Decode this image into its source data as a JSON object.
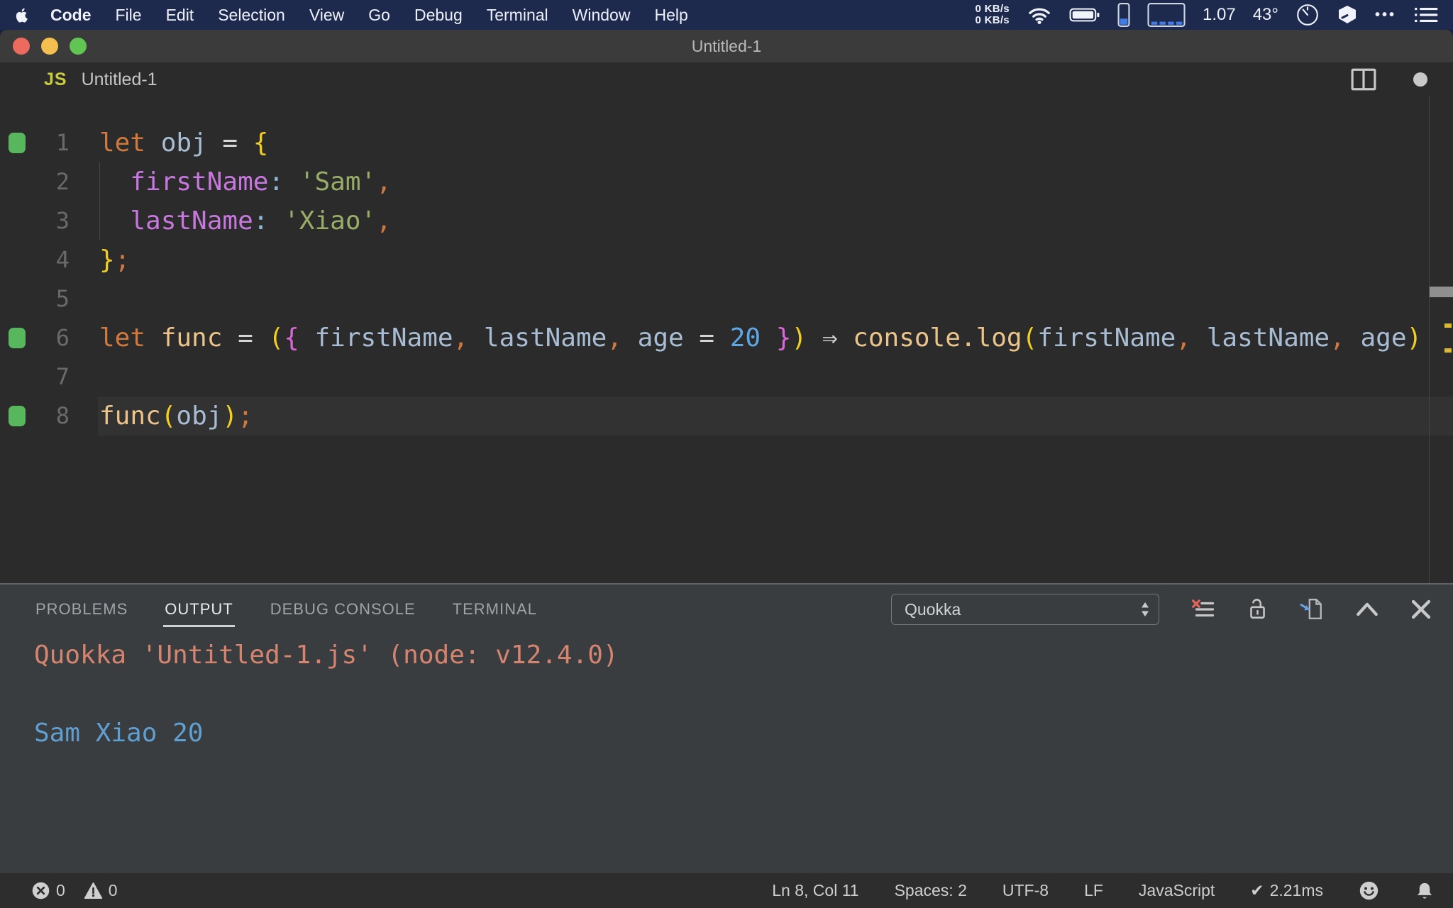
{
  "menubar": {
    "items": [
      "Code",
      "File",
      "Edit",
      "Selection",
      "View",
      "Go",
      "Debug",
      "Terminal",
      "Window",
      "Help"
    ],
    "net_up": "0 KB/s",
    "net_down": "0 KB/s",
    "stat1": "1.07",
    "stat2": "43°",
    "more_glyph": "•••"
  },
  "window": {
    "title": "Untitled-1"
  },
  "tabbar": {
    "file_badge": "JS",
    "filename": "Untitled-1"
  },
  "colors": {
    "kw": "#d0793c",
    "var": "#a8bdd3",
    "op": "#d6d6d6",
    "b1": "#f2cf1f",
    "b2": "#dc66dc",
    "prop": "#c678dd",
    "colon": "#8fb9d6",
    "str": "#98ad68",
    "comma": "#d0793c",
    "func": "#ecc48a",
    "num": "#5ea7e5",
    "plain": "#cccccc",
    "mark": "#58b65c",
    "outSalmon": "#d5846f",
    "outBlue": "#5f9fd2"
  },
  "editor": {
    "lines": [
      {
        "n": "1",
        "mark": true,
        "tokens": [
          [
            "let ",
            "kw"
          ],
          [
            "obj ",
            "var"
          ],
          [
            "= ",
            "op"
          ],
          [
            "{",
            "b1"
          ]
        ]
      },
      {
        "n": "2",
        "guide": true,
        "tokens": [
          [
            "  ",
            "plain"
          ],
          [
            "firstName",
            "prop"
          ],
          [
            ":",
            "colon"
          ],
          [
            " ",
            "plain"
          ],
          [
            "'Sam'",
            "str"
          ],
          [
            ",",
            "comma"
          ]
        ]
      },
      {
        "n": "3",
        "guide": true,
        "tokens": [
          [
            "  ",
            "plain"
          ],
          [
            "lastName",
            "prop"
          ],
          [
            ":",
            "colon"
          ],
          [
            " ",
            "plain"
          ],
          [
            "'Xiao'",
            "str"
          ],
          [
            ",",
            "comma"
          ]
        ]
      },
      {
        "n": "4",
        "tokens": [
          [
            "}",
            "b1"
          ],
          [
            ";",
            "comma"
          ]
        ]
      },
      {
        "n": "5",
        "tokens": []
      },
      {
        "n": "6",
        "mark": true,
        "tokens": [
          [
            "let ",
            "kw"
          ],
          [
            "func ",
            "func"
          ],
          [
            "= ",
            "op"
          ],
          [
            "(",
            "b1"
          ],
          [
            "{ ",
            "b2"
          ],
          [
            "firstName",
            "var"
          ],
          [
            ", ",
            "comma"
          ],
          [
            "lastName",
            "var"
          ],
          [
            ", ",
            "comma"
          ],
          [
            "age ",
            "var"
          ],
          [
            "= ",
            "op"
          ],
          [
            "20 ",
            "num"
          ],
          [
            "}",
            "b2"
          ],
          [
            ") ",
            "b1"
          ],
          [
            "⇒ ",
            "op"
          ],
          [
            "console.log",
            "func"
          ],
          [
            "(",
            "b1"
          ],
          [
            "firstName",
            "var"
          ],
          [
            ", ",
            "comma"
          ],
          [
            "lastName",
            "var"
          ],
          [
            ", ",
            "comma"
          ],
          [
            "age",
            "var"
          ],
          [
            ")",
            "b1"
          ]
        ]
      },
      {
        "n": "7",
        "tokens": []
      },
      {
        "n": "8",
        "mark": true,
        "current": true,
        "tokens": [
          [
            "func",
            "func"
          ],
          [
            "(",
            "b1"
          ],
          [
            "obj",
            "var"
          ],
          [
            ")",
            "b1"
          ],
          [
            ";",
            "comma"
          ]
        ]
      }
    ]
  },
  "panel": {
    "tabs": [
      {
        "label": "PROBLEMS",
        "active": false
      },
      {
        "label": "OUTPUT",
        "active": true
      },
      {
        "label": "DEBUG CONSOLE",
        "active": false
      },
      {
        "label": "TERMINAL",
        "active": false
      }
    ],
    "channel": "Quokka",
    "output": [
      {
        "text": "Quokka 'Untitled-1.js' (node: v12.4.0)",
        "color": "outSalmon"
      },
      {
        "text": "",
        "color": "plain"
      },
      {
        "text": "Sam Xiao 20",
        "color": "outBlue"
      }
    ]
  },
  "statusbar": {
    "errors": "0",
    "warnings": "0",
    "items": [
      "Ln 8, Col 11",
      "Spaces: 2",
      "UTF-8",
      "LF",
      "JavaScript"
    ],
    "perf_check": "✔",
    "perf": "2.21ms"
  }
}
